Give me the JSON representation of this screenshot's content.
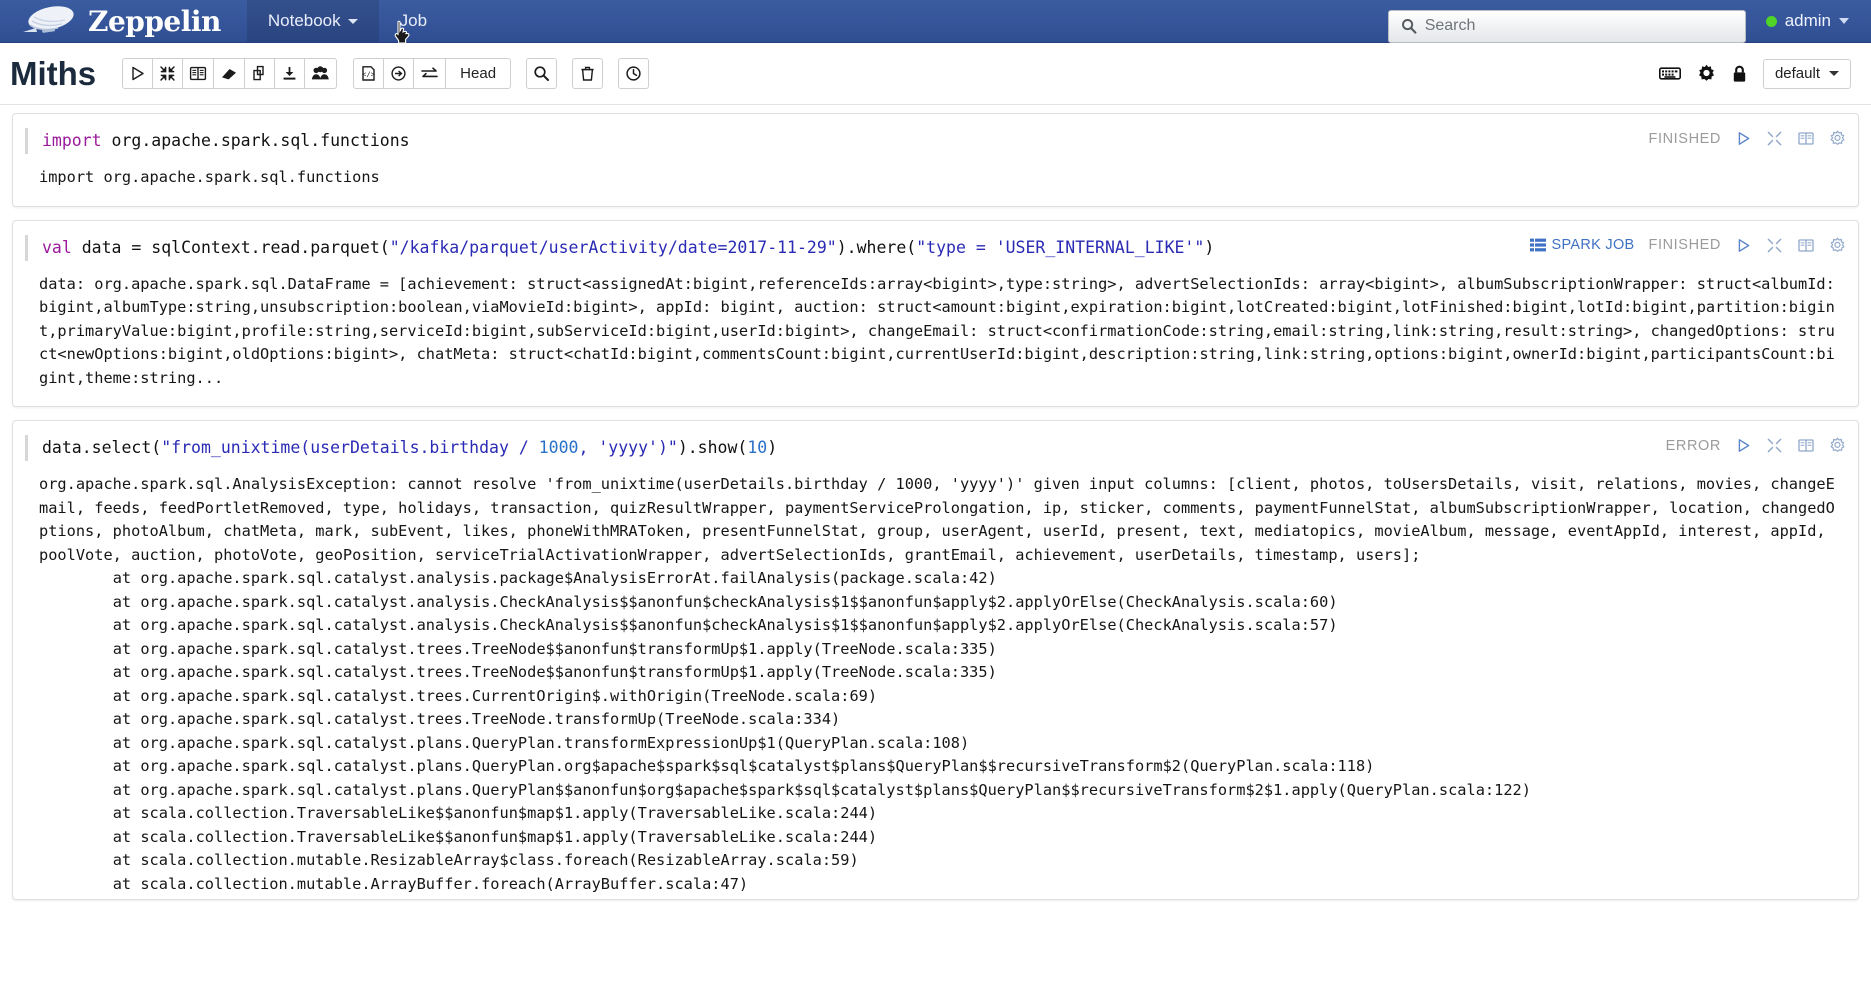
{
  "navbar": {
    "brand": "Zeppelin",
    "items": [
      {
        "label": "Notebook",
        "icon": "chevron-down-icon",
        "active": true
      },
      {
        "label": "Job",
        "icon": "",
        "active": false
      }
    ],
    "search": {
      "placeholder": "Search",
      "value": "",
      "icon": "search-icon"
    },
    "user": {
      "name": "admin",
      "status": "online",
      "status_color": "#4fd427"
    }
  },
  "note_header": {
    "title": "Miths",
    "group1": [
      {
        "name": "run-all-paragraphs-button",
        "icon": "play-icon"
      },
      {
        "name": "hide-all-editors-button",
        "icon": "collapse-icon"
      },
      {
        "name": "show-hide-output-button",
        "icon": "book-icon"
      },
      {
        "name": "clear-output-button",
        "icon": "eraser-icon"
      },
      {
        "name": "clone-note-button",
        "icon": "copy-icon"
      },
      {
        "name": "export-note-button",
        "icon": "download-icon"
      },
      {
        "name": "permissions-button",
        "icon": "users-icon"
      }
    ],
    "group2": [
      {
        "name": "note-code-button",
        "icon": "code-file-icon"
      },
      {
        "name": "commit-button",
        "icon": "circle-arrow-icon"
      },
      {
        "name": "revision-compare-button",
        "icon": "swap-icon"
      },
      {
        "name": "revision-head-label",
        "icon": "",
        "label": "Head"
      }
    ],
    "search_button": {
      "name": "find-replace-button",
      "icon": "search-icon"
    },
    "delete_button": {
      "name": "delete-note-button",
      "icon": "trash-icon"
    },
    "schedule_button": {
      "name": "scheduler-button",
      "icon": "clock-icon"
    },
    "right_icons": [
      {
        "name": "keyboard-shortcuts-icon",
        "icon": "keyboard-icon"
      },
      {
        "name": "note-settings-icon",
        "icon": "gear-icon"
      },
      {
        "name": "note-permissions-icon",
        "icon": "lock-icon"
      }
    ],
    "interpreter_binding": {
      "label": "default",
      "icon": "chevron-down-icon"
    }
  },
  "status_labels": {
    "finished": "FINISHED",
    "error": "ERROR",
    "spark_job": "SPARK JOB"
  },
  "paragraph_icons": [
    {
      "name": "run-paragraph-icon",
      "icon": "play-icon"
    },
    {
      "name": "hide-editor-icon",
      "icon": "collapse-icon"
    },
    {
      "name": "hide-output-icon",
      "icon": "book-icon"
    },
    {
      "name": "paragraph-settings-icon",
      "icon": "gear-icon"
    }
  ],
  "paragraphs": [
    {
      "id": "paragraph-import",
      "code_plain": "import org.apache.spark.sql.functions",
      "code_keyword": "import",
      "code_rest": " org.apache.spark.sql.functions",
      "status": "FINISHED",
      "has_spark_job": false,
      "output": "import org.apache.spark.sql.functions"
    },
    {
      "id": "paragraph-load-data",
      "code_keyword": "val",
      "code_mid": " data = sqlContext.read.parquet(",
      "code_str1": "\"/kafka/parquet/userActivity/date=2017-11-29\"",
      "code_mid2": ").where(",
      "code_str2": "\"type = 'USER_INTERNAL_LIKE'\"",
      "code_end": ")",
      "status": "FINISHED",
      "has_spark_job": true,
      "output": "data: org.apache.spark.sql.DataFrame = [achievement: struct<assignedAt:bigint,referenceIds:array<bigint>,type:string>, advertSelectionIds: array<bigint>, albumSubscriptionWrapper: struct<albumId:bigint,albumType:string,unsubscription:boolean,viaMovieId:bigint>, appId: bigint, auction: struct<amount:bigint,expiration:bigint,lotCreated:bigint,lotFinished:bigint,lotId:bigint,partition:bigint,primaryValue:bigint,profile:string,serviceId:bigint,subServiceId:bigint,userId:bigint>, changeEmail: struct<confirmationCode:string,email:string,link:string,result:string>, changedOptions: struct<newOptions:bigint,oldOptions:bigint>, chatMeta: struct<chatId:bigint,commentsCount:bigint,currentUserId:bigint,description:string,link:string,options:bigint,ownerId:bigint,participantsCount:bigint,theme:string..."
    },
    {
      "id": "paragraph-select-error",
      "code_pre": "data.select(",
      "code_str1": "\"from_unixtime(userDetails.birthday / ",
      "code_num1": "1000",
      "code_str2": ", 'yyyy')\"",
      "code_mid": ").show(",
      "code_num2": "10",
      "code_end": ")",
      "status": "ERROR",
      "has_spark_job": false,
      "output": "org.apache.spark.sql.AnalysisException: cannot resolve 'from_unixtime(userDetails.birthday / 1000, 'yyyy')' given input columns: [client, photos, toUsersDetails, visit, relations, movies, changeEmail, feeds, feedPortletRemoved, type, holidays, transaction, quizResultWrapper, paymentServiceProlongation, ip, sticker, comments, paymentFunnelStat, albumSubscriptionWrapper, location, changedOptions, photoAlbum, chatMeta, mark, subEvent, likes, phoneWithMRAToken, presentFunnelStat, group, userAgent, userId, present, text, mediatopics, movieAlbum, message, eventAppId, interest, appId, poolVote, auction, photoVote, geoPosition, serviceTrialActivationWrapper, advertSelectionIds, grantEmail, achievement, userDetails, timestamp, users];\n\tat org.apache.spark.sql.catalyst.analysis.package$AnalysisErrorAt.failAnalysis(package.scala:42)\n\tat org.apache.spark.sql.catalyst.analysis.CheckAnalysis$$anonfun$checkAnalysis$1$$anonfun$apply$2.applyOrElse(CheckAnalysis.scala:60)\n\tat org.apache.spark.sql.catalyst.analysis.CheckAnalysis$$anonfun$checkAnalysis$1$$anonfun$apply$2.applyOrElse(CheckAnalysis.scala:57)\n\tat org.apache.spark.sql.catalyst.trees.TreeNode$$anonfun$transformUp$1.apply(TreeNode.scala:335)\n\tat org.apache.spark.sql.catalyst.trees.TreeNode$$anonfun$transformUp$1.apply(TreeNode.scala:335)\n\tat org.apache.spark.sql.catalyst.trees.CurrentOrigin$.withOrigin(TreeNode.scala:69)\n\tat org.apache.spark.sql.catalyst.trees.TreeNode.transformUp(TreeNode.scala:334)\n\tat org.apache.spark.sql.catalyst.plans.QueryPlan.transformExpressionUp$1(QueryPlan.scala:108)\n\tat org.apache.spark.sql.catalyst.plans.QueryPlan.org$apache$spark$sql$catalyst$plans$QueryPlan$$recursiveTransform$2(QueryPlan.scala:118)\n\tat org.apache.spark.sql.catalyst.plans.QueryPlan$$anonfun$org$apache$spark$sql$catalyst$plans$QueryPlan$$recursiveTransform$2$1.apply(QueryPlan.scala:122)\n\tat scala.collection.TraversableLike$$anonfun$map$1.apply(TraversableLike.scala:244)\n\tat scala.collection.TraversableLike$$anonfun$map$1.apply(TraversableLike.scala:244)\n\tat scala.collection.mutable.ResizableArray$class.foreach(ResizableArray.scala:59)\n\tat scala.collection.mutable.ArrayBuffer.foreach(ArrayBuffer.scala:47)"
    }
  ],
  "colors": {
    "navbar_bg": "#36559a",
    "accent_blue": "#3f72c4",
    "keyword_purple": "#9b1a9b",
    "string_blue": "#2a2ab5",
    "number_blue": "#2a70c7",
    "status_gray": "#9b9b9b",
    "online_green": "#4fd427"
  }
}
